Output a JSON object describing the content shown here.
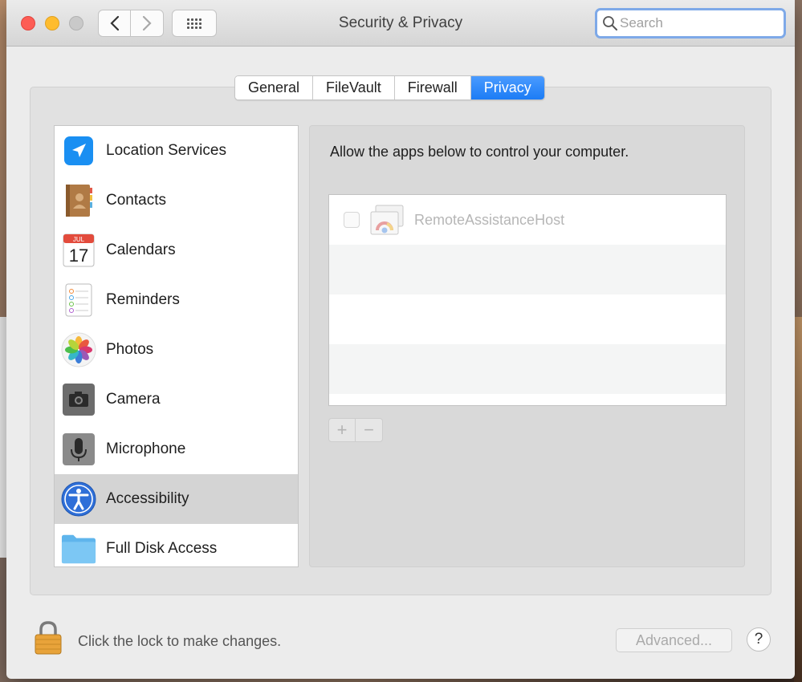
{
  "window": {
    "title": "Security & Privacy",
    "search_placeholder": "Search"
  },
  "nav": {
    "back_icon": "chevron-left-icon",
    "forward_icon": "chevron-right-icon",
    "grid_icon": "grid-icon"
  },
  "tabs": [
    {
      "label": "General",
      "active": false
    },
    {
      "label": "FileVault",
      "active": false
    },
    {
      "label": "Firewall",
      "active": false
    },
    {
      "label": "Privacy",
      "active": true
    }
  ],
  "sidebar": {
    "items": [
      {
        "label": "Location Services",
        "icon": "location-arrow-icon",
        "selected": false
      },
      {
        "label": "Contacts",
        "icon": "contacts-book-icon",
        "selected": false
      },
      {
        "label": "Calendars",
        "icon": "calendar-icon",
        "selected": false,
        "icon_month": "JUL",
        "icon_day": "17"
      },
      {
        "label": "Reminders",
        "icon": "reminders-list-icon",
        "selected": false
      },
      {
        "label": "Photos",
        "icon": "photos-flower-icon",
        "selected": false
      },
      {
        "label": "Camera",
        "icon": "camera-icon",
        "selected": false
      },
      {
        "label": "Microphone",
        "icon": "microphone-icon",
        "selected": false
      },
      {
        "label": "Accessibility",
        "icon": "accessibility-icon",
        "selected": true
      },
      {
        "label": "Full Disk Access",
        "icon": "folder-icon",
        "selected": false
      }
    ]
  },
  "content": {
    "intro": "Allow the apps below to control your computer.",
    "apps": [
      {
        "name": "RemoteAssistanceHost",
        "checked": false,
        "icon": "chrome-remote-desktop-icon"
      }
    ],
    "add_label": "+",
    "remove_label": "−"
  },
  "footer": {
    "lock_text": "Click the lock to make changes.",
    "advanced_label": "Advanced...",
    "help_label": "?"
  },
  "colors": {
    "accent": "#1c7cf5",
    "window_bg": "#ececec",
    "selected_row": "#d4d4d4"
  }
}
